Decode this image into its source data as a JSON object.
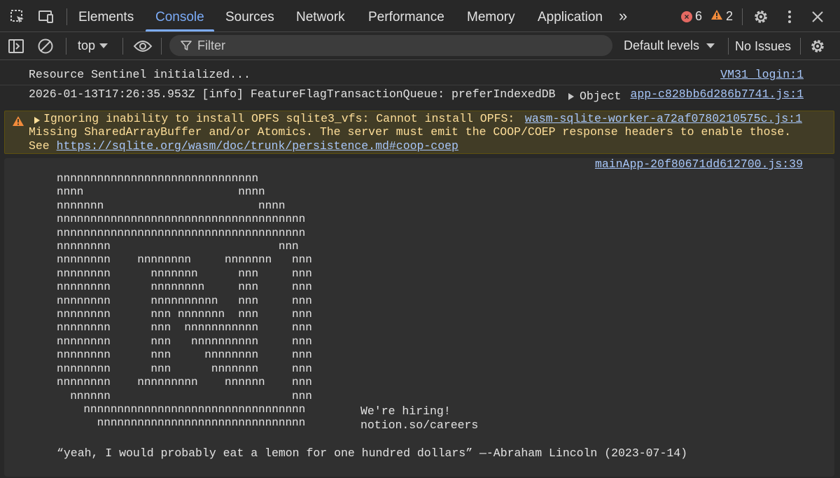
{
  "tabs": {
    "elements": "Elements",
    "console": "Console",
    "sources": "Sources",
    "network": "Network",
    "performance": "Performance",
    "memory": "Memory",
    "application": "Application",
    "more": "»"
  },
  "badges": {
    "errors": "6",
    "warnings": "2"
  },
  "toolbar": {
    "context": "top",
    "filter_placeholder": "Filter",
    "levels": "Default levels",
    "issues": "No Issues"
  },
  "messages": [
    {
      "text": "Resource Sentinel initialized...",
      "source": "VM31 login:1"
    },
    {
      "text": "2026-01-13T17:26:35.953Z [info] FeatureFlagTransactionQueue: preferIndexedDB",
      "object": "Object",
      "source": "app-c828bb6d286b7741.js:1"
    }
  ],
  "warning": {
    "line1": "Ignoring inability to install OPFS sqlite3_vfs: Cannot install OPFS:",
    "line2": "Missing SharedArrayBuffer and/or Atomics. The server must emit the COOP/COEP response headers to enable those.",
    "see": "See ",
    "link": "https://sqlite.org/wasm/doc/trunk/persistence.md#coop-coep",
    "source": "wasm-sqlite-worker-a72af0780210575c.js:1"
  },
  "art_message": {
    "source": "mainApp-20f80671dd612700.js:39",
    "art": "nnnnnnnnnnnnnnnnnnnnnnnnnnnnnn\nnnnn                       nnnn\nnnnnnnn                       nnnn\nnnnnnnnnnnnnnnnnnnnnnnnnnnnnnnnnnnnnn\nnnnnnnnnnnnnnnnnnnnnnnnnnnnnnnnnnnnnn\nnnnnnnnn                         nnn\nnnnnnnnn    nnnnnnnn     nnnnnnn   nnn\nnnnnnnnn      nnnnnnn      nnn     nnn\nnnnnnnnn      nnnnnnnn     nnn     nnn\nnnnnnnnn      nnnnnnnnnn   nnn     nnn\nnnnnnnnn      nnn nnnnnnn  nnn     nnn\nnnnnnnnn      nnn  nnnnnnnnnnn     nnn\nnnnnnnnn      nnn   nnnnnnnnnn     nnn\nnnnnnnnn      nnn     nnnnnnnn     nnn\nnnnnnnnn      nnn      nnnnnnn     nnn\nnnnnnnnn    nnnnnnnnn    nnnnnn    nnn\n  nnnnnn                           nnn\n    nnnnnnnnnnnnnnnnnnnnnnnnnnnnnnnnn\n      nnnnnnnnnnnnnnnnnnnnnnnnnnnnnnn",
    "hiring": "We're hiring!",
    "careers": "notion.so/careers",
    "quote": "“yeah, I would probably eat a lemon for one hundred dollars” —-Abraham Lincoln (2023-07-14)"
  },
  "colors": {
    "accent": "#7cacf8",
    "error": "#e46962",
    "warning": "#f28b3b",
    "warning_bg": "#413c26",
    "link": "#a8c7fa"
  }
}
